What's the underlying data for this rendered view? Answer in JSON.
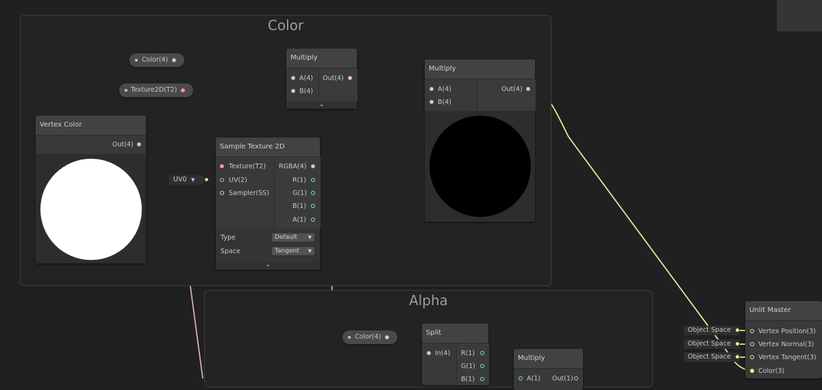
{
  "groups": {
    "color": {
      "title": "Color"
    },
    "alpha": {
      "title": "Alpha"
    }
  },
  "properties": {
    "color_top": "Color(4)",
    "texture": "Texture2D(T2)",
    "color_alpha": "Color(4)"
  },
  "vertex_color": {
    "title": "Vertex Color",
    "out": "Out(4)",
    "preview_color": "#ffffff"
  },
  "multiply1": {
    "title": "Multiply",
    "in_a": "A(4)",
    "in_b": "B(4)",
    "out": "Out(4)"
  },
  "multiply2": {
    "title": "Multiply",
    "in_a": "A(4)",
    "in_b": "B(4)",
    "out": "Out(4)",
    "preview_color": "#000000"
  },
  "sample_texture": {
    "title": "Sample Texture 2D",
    "inputs": [
      "Texture(T2)",
      "UV(2)",
      "Sampler(SS)"
    ],
    "outputs": [
      "RGBA(4)",
      "R(1)",
      "G(1)",
      "B(1)",
      "A(1)"
    ],
    "uv_slot": "UV0",
    "type_label": "Type",
    "type_value": "Default",
    "space_label": "Space",
    "space_value": "Tangent"
  },
  "split": {
    "title": "Split",
    "in": "In(4)",
    "outputs": [
      "R(1)",
      "G(1)",
      "B(1)"
    ]
  },
  "multiply3": {
    "title": "Multiply",
    "in_a": "A(1)",
    "out": "Out(1)"
  },
  "master": {
    "title": "Unlit Master",
    "inputs": [
      "Vertex Position(3)",
      "Vertex Normal(3)",
      "Vertex Tangent(3)",
      "Color(3)"
    ],
    "slots": [
      "Object Space",
      "Object Space",
      "Object Space"
    ]
  },
  "colors": {
    "wire_vector4": "#d9a7d0",
    "wire_texture": "#ff8a70",
    "wire_vector3": "#e8e6a0",
    "wire_vector2": "#a5e58e"
  }
}
